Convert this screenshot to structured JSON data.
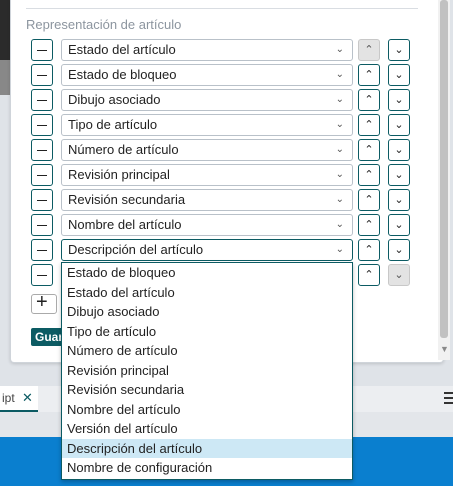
{
  "section_title": "Representación de artículo",
  "rows": [
    {
      "label": "Estado del artículo",
      "up_disabled": true,
      "down_disabled": false
    },
    {
      "label": "Estado de bloqueo",
      "up_disabled": false,
      "down_disabled": false
    },
    {
      "label": "Dibujo asociado",
      "up_disabled": false,
      "down_disabled": false
    },
    {
      "label": "Tipo de artículo",
      "up_disabled": false,
      "down_disabled": false
    },
    {
      "label": "Número de artículo",
      "up_disabled": false,
      "down_disabled": false
    },
    {
      "label": "Revisión principal",
      "up_disabled": false,
      "down_disabled": false
    },
    {
      "label": "Revisión secundaria",
      "up_disabled": false,
      "down_disabled": false
    },
    {
      "label": "Nombre del artículo",
      "up_disabled": false,
      "down_disabled": false
    },
    {
      "label": "Descripción del artículo",
      "up_disabled": false,
      "down_disabled": false,
      "open": true
    },
    {
      "label": "",
      "up_disabled": false,
      "down_disabled": true
    }
  ],
  "dropdown_options": [
    "Estado de bloqueo",
    "Estado del artículo",
    "Dibujo asociado",
    "Tipo de artículo",
    "Número de artículo",
    "Revisión principal",
    "Revisión secundaria",
    "Nombre del artículo",
    "Versión del artículo",
    "Descripción del artículo",
    "Nombre de configuración"
  ],
  "dropdown_selected": "Descripción del artículo",
  "save_label": "Guardar",
  "tab": {
    "label": "ipt",
    "close": "✕"
  },
  "icons": {
    "up": "chevron-up-icon",
    "down": "chevron-down-icon",
    "remove": "minus-icon",
    "add": "plus-icon"
  },
  "colors": {
    "accent": "#0c5b63",
    "selected_option": "#cde8f5",
    "taskbar": "#0a7fcf"
  }
}
